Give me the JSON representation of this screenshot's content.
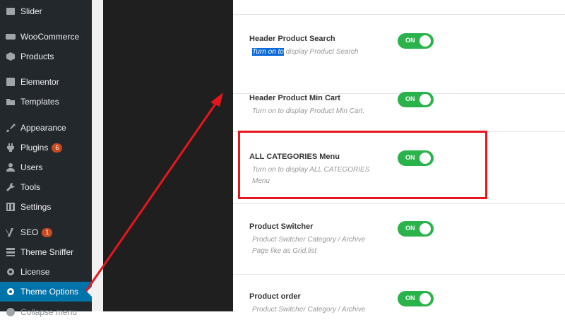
{
  "sidebar": {
    "items": [
      {
        "label": "Slider",
        "icon": "slider-icon",
        "badge": null
      },
      {
        "label": "WooCommerce",
        "icon": "woocommerce-icon",
        "badge": null
      },
      {
        "label": "Products",
        "icon": "products-icon",
        "badge": null
      },
      {
        "label": "Elementor",
        "icon": "elementor-icon",
        "badge": null
      },
      {
        "label": "Templates",
        "icon": "folder-icon",
        "badge": null
      },
      {
        "label": "Appearance",
        "icon": "brush-icon",
        "badge": null
      },
      {
        "label": "Plugins",
        "icon": "plugin-icon",
        "badge": "6"
      },
      {
        "label": "Users",
        "icon": "user-icon",
        "badge": null
      },
      {
        "label": "Tools",
        "icon": "wrench-icon",
        "badge": null
      },
      {
        "label": "Settings",
        "icon": "settings-icon",
        "badge": null
      },
      {
        "label": "SEO",
        "icon": "yoast-icon",
        "badge": "1"
      },
      {
        "label": "Theme Sniffer",
        "icon": "list-icon",
        "badge": null
      },
      {
        "label": "License",
        "icon": "gear-icon",
        "badge": null
      },
      {
        "label": "Theme Options",
        "icon": "gear-icon",
        "badge": null
      },
      {
        "label": "Collapse menu",
        "icon": "collapse-icon",
        "badge": null
      }
    ]
  },
  "settings": [
    {
      "title": "Header Product Search",
      "desc_selected": "Turn on to",
      "desc_rest": " display Product Search",
      "toggle": "ON"
    },
    {
      "title": "Header Product Min Cart",
      "desc": "Turn on to display Product Min Cart.",
      "toggle": "ON"
    },
    {
      "title": "ALL CATEGORIES Menu",
      "desc": "Turn on to display ALL CATEGORIES Menu",
      "toggle": "ON"
    },
    {
      "title": "Product Switcher",
      "desc": "Product Switcher Category / Archive Page like as Grid,list",
      "toggle": "ON"
    },
    {
      "title": "Product order",
      "desc": "Product Switcher Category / Archive",
      "toggle": "ON"
    }
  ],
  "colors": {
    "active_menu": "#0073aa",
    "toggle_on": "#29b34a",
    "annotation": "#e8161c"
  }
}
